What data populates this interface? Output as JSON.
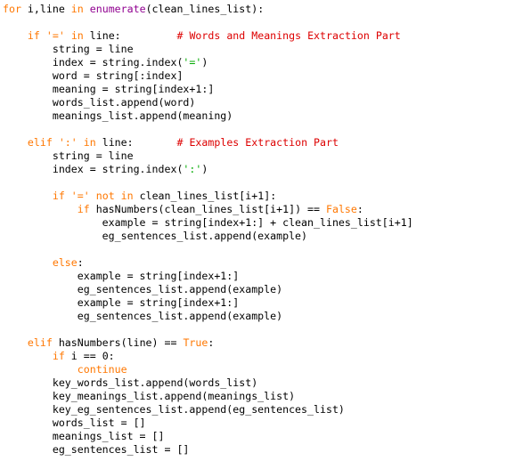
{
  "editor": {
    "language": "python",
    "colors": {
      "keyword": "#ff7700",
      "builtin": "#900090",
      "comment": "#dd0000",
      "string": "#00aa00",
      "text": "#000000",
      "background": "#ffffff"
    },
    "lines": [
      [
        {
          "t": "for",
          "c": "kw"
        },
        {
          "t": " i,line "
        },
        {
          "t": "in",
          "c": "kw"
        },
        {
          "t": " "
        },
        {
          "t": "enumerate",
          "c": "bi"
        },
        {
          "t": "(clean_lines_list):"
        }
      ],
      [],
      [
        {
          "t": "    "
        },
        {
          "t": "if",
          "c": "kw"
        },
        {
          "t": " "
        },
        {
          "t": "'='",
          "c": "kw"
        },
        {
          "t": " "
        },
        {
          "t": "in",
          "c": "kw"
        },
        {
          "t": " line:         "
        },
        {
          "t": "# Words and Meanings Extraction Part",
          "c": "cm"
        }
      ],
      [
        {
          "t": "        string = line"
        }
      ],
      [
        {
          "t": "        index = string.index("
        },
        {
          "t": "'='",
          "c": "st"
        },
        {
          "t": ")"
        }
      ],
      [
        {
          "t": "        word = string[:index]"
        }
      ],
      [
        {
          "t": "        meaning = string[index+1:]"
        }
      ],
      [
        {
          "t": "        words_list.append(word)"
        }
      ],
      [
        {
          "t": "        meanings_list.append(meaning)"
        }
      ],
      [],
      [
        {
          "t": "    "
        },
        {
          "t": "elif",
          "c": "kw"
        },
        {
          "t": " "
        },
        {
          "t": "':'",
          "c": "kw"
        },
        {
          "t": " "
        },
        {
          "t": "in",
          "c": "kw"
        },
        {
          "t": " line:       "
        },
        {
          "t": "# Examples Extraction Part",
          "c": "cm"
        }
      ],
      [
        {
          "t": "        string = line"
        }
      ],
      [
        {
          "t": "        index = string.index("
        },
        {
          "t": "':'",
          "c": "st"
        },
        {
          "t": ")"
        }
      ],
      [],
      [
        {
          "t": "        "
        },
        {
          "t": "if",
          "c": "kw"
        },
        {
          "t": " "
        },
        {
          "t": "'='",
          "c": "kw"
        },
        {
          "t": " "
        },
        {
          "t": "not",
          "c": "kw"
        },
        {
          "t": " "
        },
        {
          "t": "in",
          "c": "kw"
        },
        {
          "t": " clean_lines_list[i+1]:"
        }
      ],
      [
        {
          "t": "            "
        },
        {
          "t": "if",
          "c": "kw"
        },
        {
          "t": " hasNumbers(clean_lines_list[i+1]) == "
        },
        {
          "t": "False",
          "c": "kw"
        },
        {
          "t": ":"
        }
      ],
      [
        {
          "t": "                example = string[index+1:] + clean_lines_list[i+1]"
        }
      ],
      [
        {
          "t": "                eg_sentences_list.append(example)"
        }
      ],
      [],
      [
        {
          "t": "        "
        },
        {
          "t": "else",
          "c": "kw"
        },
        {
          "t": ":"
        }
      ],
      [
        {
          "t": "            example = string[index+1:]"
        }
      ],
      [
        {
          "t": "            eg_sentences_list.append(example)"
        }
      ],
      [
        {
          "t": "            example = string[index+1:]"
        }
      ],
      [
        {
          "t": "            eg_sentences_list.append(example)"
        }
      ],
      [],
      [
        {
          "t": "    "
        },
        {
          "t": "elif",
          "c": "kw"
        },
        {
          "t": " hasNumbers(line) == "
        },
        {
          "t": "True",
          "c": "kw"
        },
        {
          "t": ":"
        }
      ],
      [
        {
          "t": "        "
        },
        {
          "t": "if",
          "c": "kw"
        },
        {
          "t": " i == 0:"
        }
      ],
      [
        {
          "t": "            "
        },
        {
          "t": "continue",
          "c": "kw"
        }
      ],
      [
        {
          "t": "        key_words_list.append(words_list)"
        }
      ],
      [
        {
          "t": "        key_meanings_list.append(meanings_list)"
        }
      ],
      [
        {
          "t": "        key_eg_sentences_list.append(eg_sentences_list)"
        }
      ],
      [
        {
          "t": "        words_list = []"
        }
      ],
      [
        {
          "t": "        meanings_list = []"
        }
      ],
      [
        {
          "t": "        eg_sentences_list = []"
        }
      ]
    ]
  }
}
